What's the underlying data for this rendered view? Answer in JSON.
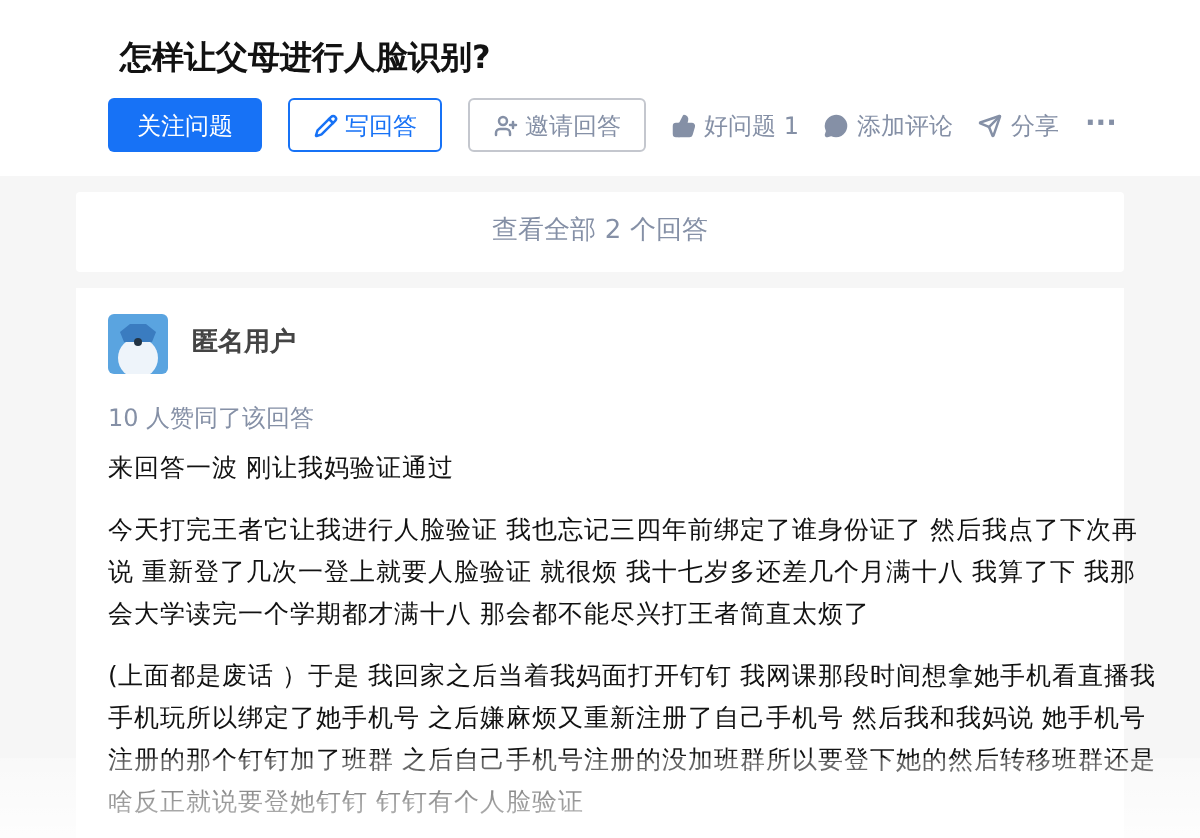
{
  "question": {
    "title": "怎样让父母进行人脸识别?"
  },
  "actions": [
    {
      "kind": "primary",
      "label": "关注问题"
    },
    {
      "kind": "outline-blue",
      "label": "写回答"
    },
    {
      "kind": "outline-gray",
      "label": "邀请回答"
    },
    {
      "kind": "plain",
      "label": "好问题 1"
    },
    {
      "kind": "plain",
      "label": "添加评论"
    },
    {
      "kind": "plain",
      "label": "分享"
    },
    {
      "kind": "more",
      "label": "···"
    }
  ],
  "view_all": {
    "label": "查看全部 2 个回答"
  },
  "answer": {
    "author": "匿名用户",
    "upvotes": "10 人赞同了该回答",
    "paragraphs": [
      "来回答一波 刚让我妈验证通过",
      "今天打完王者它让我进行人脸验证 我也忘记三四年前绑定了谁身份证了 然后我点了下次再说 重新登了几次一登上就要人脸验证 就很烦 我十七岁多还差几个月满十八 我算了下 我那会大学读完一个学期都才满十八 那会都不能尽兴打王者简直太烦了",
      "(上面都是废话 ）于是 我回家之后当着我妈面打开钉钉 我网课那段时间想拿她手机看直播我手机玩所以绑定了她手机号 之后嫌麻烦又重新注册了自己手机号 然后我和我妈说 她手机号注册的那个钉钉加了班群 之后自己手机号注册的没加班群所以要登下她的然后转移班群还是啥反正就说要登她钉钉 钉钉有个人脸验证"
    ]
  }
}
